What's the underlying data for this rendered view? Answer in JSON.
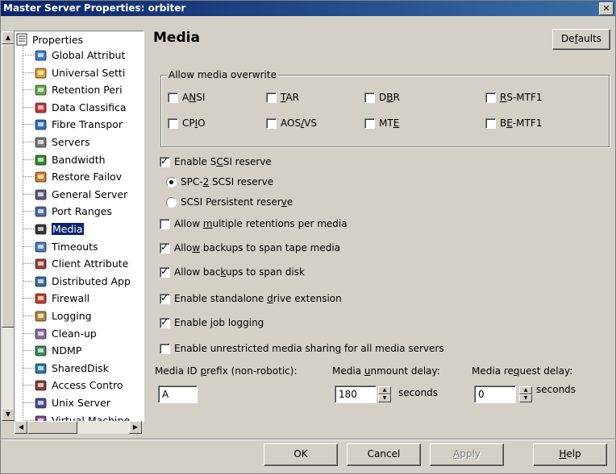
{
  "window": {
    "title": "Master Server Properties: orbiter",
    "close_glyph": "✕"
  },
  "tree": {
    "root_label": "Properties",
    "items": [
      {
        "label": "Global Attribut",
        "icon": "globe-icon"
      },
      {
        "label": "Universal Setti",
        "icon": "universal-settings-icon"
      },
      {
        "label": "Retention Peri",
        "icon": "retention-icon"
      },
      {
        "label": "Data Classifica",
        "icon": "data-classification-icon"
      },
      {
        "label": "Fibre Transpor",
        "icon": "fibre-transport-icon"
      },
      {
        "label": "Servers",
        "icon": "servers-icon"
      },
      {
        "label": "Bandwidth",
        "icon": "bandwidth-icon"
      },
      {
        "label": "Restore Failov",
        "icon": "restore-failover-icon"
      },
      {
        "label": "General Server",
        "icon": "general-server-icon"
      },
      {
        "label": "Port Ranges",
        "icon": "port-ranges-icon"
      },
      {
        "label": "Media",
        "icon": "media-icon",
        "selected": true
      },
      {
        "label": "Timeouts",
        "icon": "timeouts-icon"
      },
      {
        "label": "Client Attribute",
        "icon": "client-attributes-icon"
      },
      {
        "label": "Distributed App",
        "icon": "distributed-app-icon"
      },
      {
        "label": "Firewall",
        "icon": "firewall-icon"
      },
      {
        "label": "Logging",
        "icon": "logging-icon"
      },
      {
        "label": "Clean-up",
        "icon": "clean-up-icon"
      },
      {
        "label": "NDMP",
        "icon": "ndmp-icon"
      },
      {
        "label": "SharedDisk",
        "icon": "shared-disk-icon"
      },
      {
        "label": "Access Contro",
        "icon": "access-control-icon"
      },
      {
        "label": "Unix Server",
        "icon": "unix-server-icon"
      },
      {
        "label": "Virtual Machine",
        "icon": "virtual-machine-icon"
      }
    ]
  },
  "main": {
    "heading": "Media",
    "defaults_button": {
      "pre": "De",
      "acc": "f",
      "post": "aults"
    },
    "overwrite_group": {
      "label": "Allow media overwrite",
      "options": [
        {
          "pre": "A",
          "acc": "N",
          "post": "SI",
          "checked": false
        },
        {
          "pre": "",
          "acc": "T",
          "post": "AR",
          "checked": false
        },
        {
          "pre": "D",
          "acc": "B",
          "post": "R",
          "checked": false
        },
        {
          "pre": "",
          "acc": "R",
          "post": "S-MTF1",
          "checked": false
        },
        {
          "pre": "CP",
          "acc": "I",
          "post": "O",
          "checked": false
        },
        {
          "pre": "AOS",
          "acc": "/",
          "post": "VS",
          "checked": false
        },
        {
          "pre": "MT",
          "acc": "E",
          "post": "",
          "checked": false
        },
        {
          "pre": "B",
          "acc": "E",
          "post": "-MTF1",
          "checked": false
        }
      ]
    },
    "scsi_reserve": {
      "pre": "Enable S",
      "acc": "C",
      "post": "SI reserve",
      "checked": true
    },
    "spc2": {
      "pre": "SPC-",
      "acc": "2",
      "post": " SCSI reserve",
      "selected": true
    },
    "persistent": {
      "pre": "SCSI Persistent reser",
      "acc": "v",
      "post": "e",
      "selected": false
    },
    "options": [
      {
        "pre": "Allow ",
        "acc": "m",
        "post": "ultiple retentions per media",
        "checked": false
      },
      {
        "pre": "Allo",
        "acc": "w",
        "post": " backups to span tape media",
        "checked": true
      },
      {
        "pre": "Allow bac",
        "acc": "k",
        "post": "ups to span disk",
        "checked": true
      },
      {
        "pre": "Enable standalone ",
        "acc": "d",
        "post": "rive extension",
        "checked": true
      },
      {
        "pre": "Enable ",
        "acc": "j",
        "post": "ob logging",
        "checked": true
      },
      {
        "pre": "Enable unrestricted media sharin",
        "acc": "g",
        "post": " for all media servers",
        "checked": false
      }
    ],
    "media_id": {
      "pre": "Media ID ",
      "acc": "p",
      "post": "refix (non-robotic):",
      "value": "A"
    },
    "unmount": {
      "pre": "Media ",
      "acc": "u",
      "post": "nmount delay:",
      "value": "180",
      "unit": "seconds"
    },
    "request": {
      "pre": "Media re",
      "acc": "q",
      "post": "uest delay:",
      "value": "0",
      "unit": "seconds"
    }
  },
  "footer": {
    "ok": "OK",
    "cancel": "Cancel",
    "apply": {
      "pre": "",
      "acc": "A",
      "post": "pply"
    },
    "help": {
      "pre": "",
      "acc": "H",
      "post": "elp"
    }
  }
}
